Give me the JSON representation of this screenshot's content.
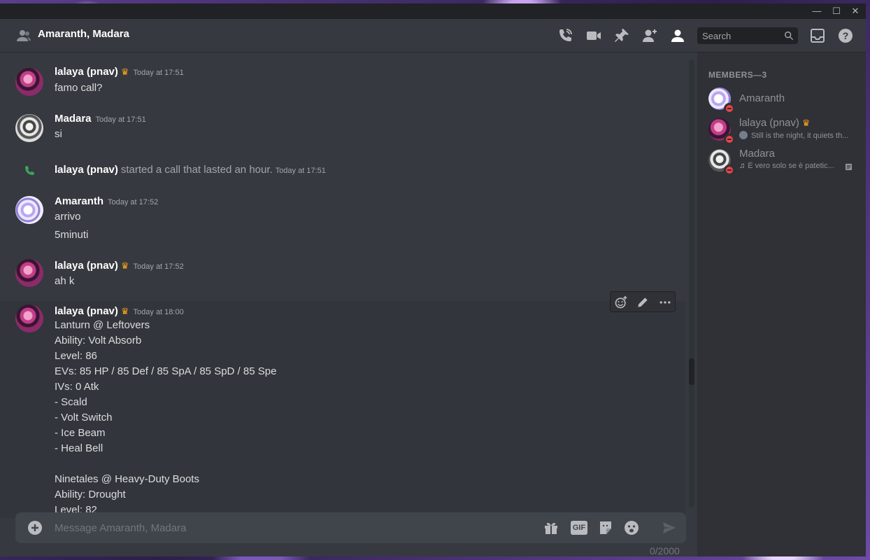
{
  "window_controls": {
    "minimize": "—",
    "maximize": "☐",
    "close": "✕"
  },
  "header": {
    "title": "Amaranth, Madara",
    "icons": [
      "people-icon",
      "call-icon",
      "video-icon",
      "pin-icon",
      "add-friend-icon",
      "member-list-icon",
      "inbox-icon",
      "help-icon"
    ],
    "search_placeholder": "Search"
  },
  "messages": [
    {
      "author": "lalaya (pnav)",
      "crown": "♛",
      "timestamp": "Today at 17:51",
      "lines": [
        "famo call?"
      ]
    },
    {
      "author": "Madara",
      "timestamp": "Today at 17:51",
      "lines": [
        "si"
      ]
    },
    {
      "system": true,
      "author": "lalaya (pnav)",
      "text": "started a call that lasted an hour.",
      "timestamp": "Today at 17:51"
    },
    {
      "author": "Amaranth",
      "timestamp": "Today at 17:52",
      "lines": [
        "arrivo",
        "5minuti"
      ]
    },
    {
      "author": "lalaya (pnav)",
      "crown": "♛",
      "timestamp": "Today at 17:52",
      "lines": [
        "ah k"
      ]
    },
    {
      "author": "lalaya (pnav)",
      "crown": "♛",
      "timestamp": "Today at 18:00",
      "lines": [
        "Lanturn @ Leftovers",
        "Ability: Volt Absorb",
        "Level: 86",
        "EVs: 85 HP / 85 Def / 85 SpA / 85 SpD / 85 Spe",
        "IVs: 0 Atk",
        "- Scald",
        "- Volt Switch",
        "- Ice Beam",
        "- Heal Bell",
        "",
        "Ninetales @ Heavy-Duty Boots",
        "Ability: Drought",
        "Level: 82"
      ]
    }
  ],
  "composer": {
    "placeholder": "Message Amaranth, Madara",
    "counter": "0/2000",
    "gif_label": "GIF"
  },
  "members": {
    "heading": "MEMBERS—3",
    "list": [
      {
        "name": "Amaranth",
        "status": ""
      },
      {
        "name": "lalaya (pnav)",
        "crown": "♛",
        "status": "Still is the night, it quiets th..."
      },
      {
        "name": "Madara",
        "status": "É vero solo se è patetic..."
      }
    ]
  },
  "colors": {
    "accent_online": "#3ba55c",
    "dnd": "#ed4245",
    "crown": "#faa61a",
    "call_green": "#3ba55c"
  }
}
